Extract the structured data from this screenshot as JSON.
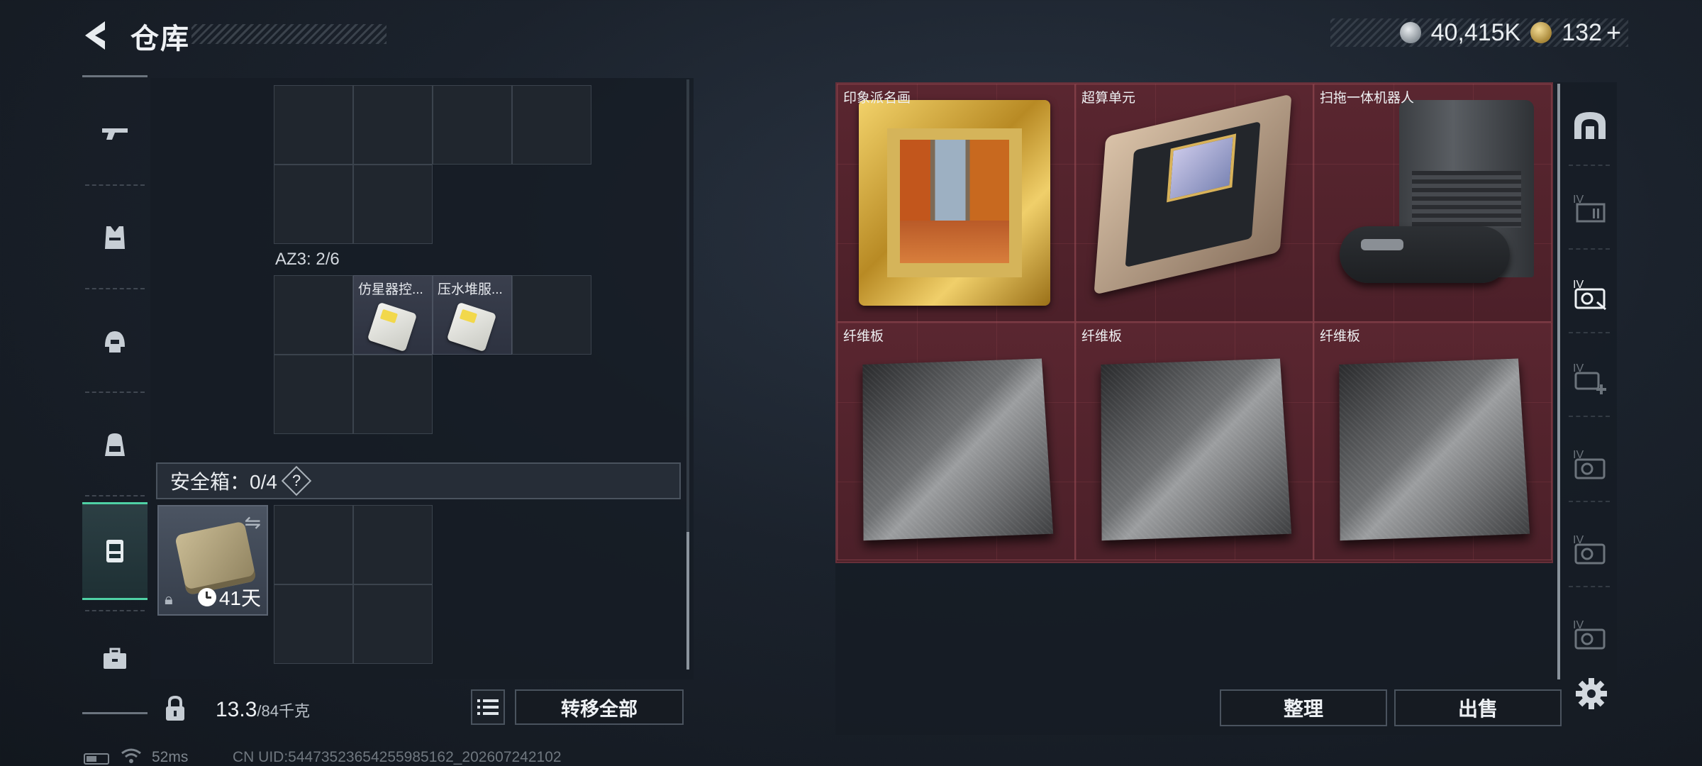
{
  "header": {
    "title": "仓库",
    "silver_amount": "40,415K",
    "gold_amount": "132",
    "plus_label": "+"
  },
  "left_tabs": [
    {
      "name": "weapon-tab",
      "icon": "gun-icon"
    },
    {
      "name": "armor-tab",
      "icon": "vest-icon"
    },
    {
      "name": "helmet-tab",
      "icon": "helmet-icon"
    },
    {
      "name": "backpack-tab",
      "icon": "backpack-icon"
    },
    {
      "name": "safebox-tab",
      "icon": "safebox-icon",
      "active": true
    },
    {
      "name": "toolbox-tab",
      "icon": "toolbox-icon"
    }
  ],
  "container": {
    "az3_label": "AZ3: 2/6",
    "items": [
      {
        "label": "仿星器控...",
        "icon": "pill-pack-icon"
      },
      {
        "label": "压水堆服...",
        "icon": "pill-pack-icon"
      }
    ]
  },
  "safebox": {
    "label": "安全箱：0/4",
    "help": "?",
    "days": "41天"
  },
  "footer_left": {
    "weight_current": "13.3",
    "weight_max": "/84千克",
    "transfer_all": "转移全部"
  },
  "stash": {
    "items": [
      {
        "label": "印象派名画",
        "art": "painting"
      },
      {
        "label": "超算单元",
        "art": "board"
      },
      {
        "label": "扫拖一体机器人",
        "art": "robot"
      },
      {
        "label": "纤维板",
        "art": "fiber"
      },
      {
        "label": "纤维板",
        "art": "fiber"
      },
      {
        "label": "纤维板",
        "art": "fiber"
      }
    ]
  },
  "right_rail_icons": [
    "home-arch-icon",
    "storage-iv-icon",
    "storage-iv-active-icon",
    "storage-iv-add-icon",
    "storage-iv-icon",
    "storage-iv-icon",
    "storage-iv-icon"
  ],
  "footer_right": {
    "sort": "整理",
    "sell": "出售"
  },
  "status": {
    "ping": "52ms",
    "uid": "CN UID:544735236542559851​62_202607242102"
  },
  "colors": {
    "accent_green": "#4fd1a5",
    "stash_bg": "#4a1f26"
  }
}
